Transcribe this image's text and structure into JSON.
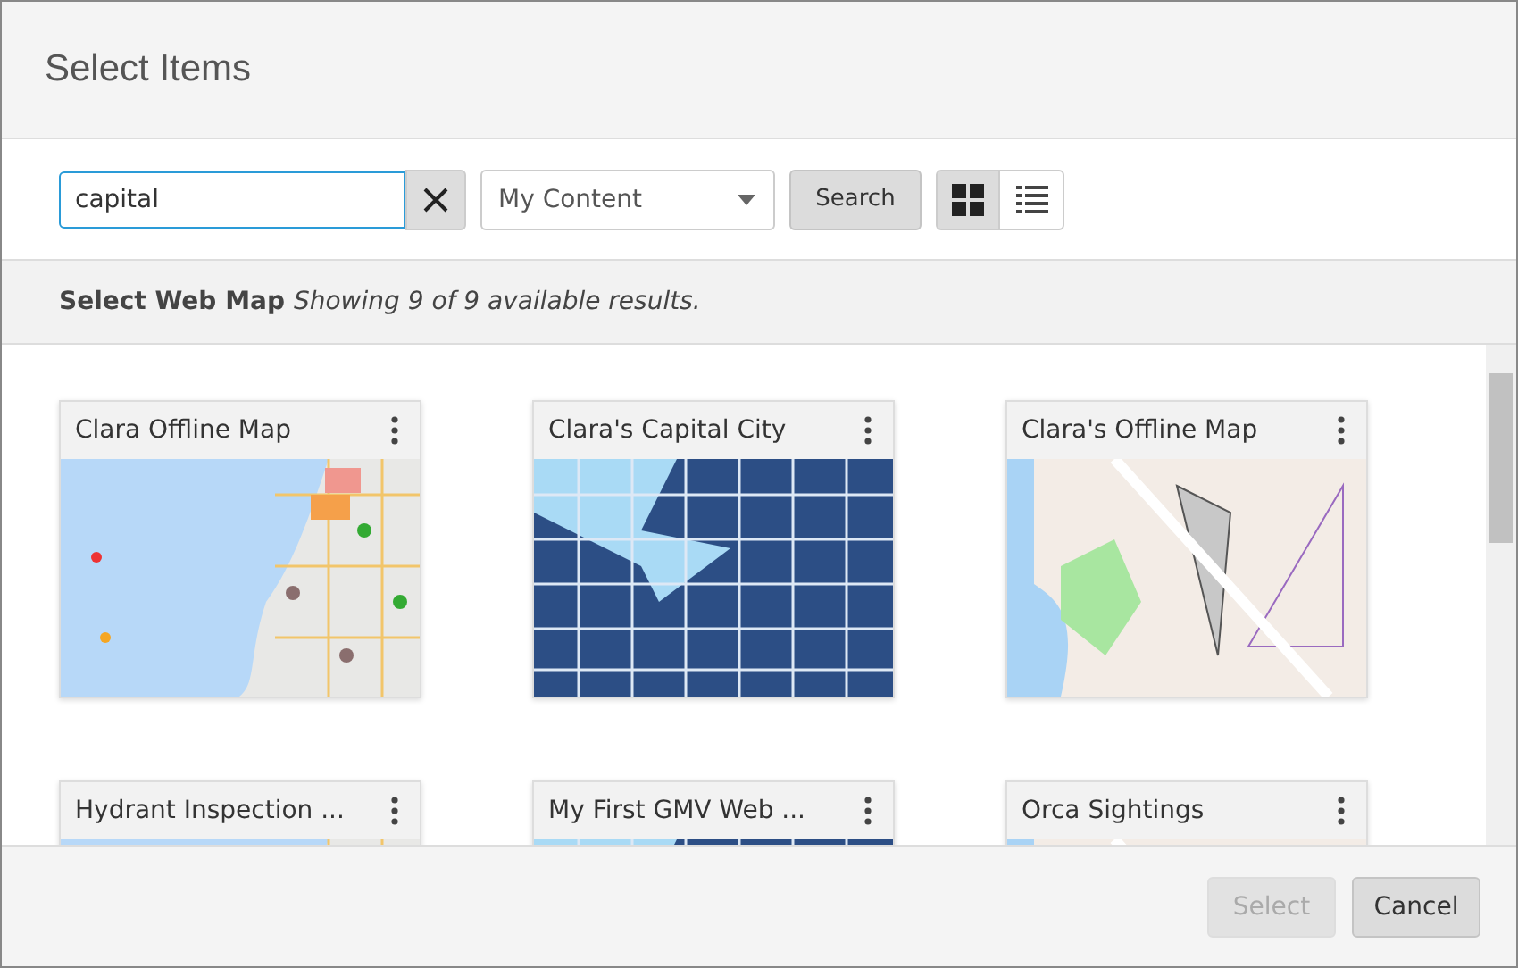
{
  "dialog": {
    "title": "Select Items"
  },
  "toolbar": {
    "search": {
      "value": "capital"
    },
    "scope": {
      "value": "My Content"
    },
    "search_button": "Search",
    "views": [
      {
        "kind": "grid",
        "selected": true
      },
      {
        "kind": "list",
        "selected": false
      }
    ]
  },
  "info": {
    "heading": "Select Web Map",
    "status": "Showing 9 of 9 available results."
  },
  "items": [
    {
      "title": "Clara Offline Map",
      "kind": "streets"
    },
    {
      "title": "Clara's Capital City",
      "kind": "parcels"
    },
    {
      "title": "Clara's Offline Map",
      "kind": "light"
    },
    {
      "title": "Hydrant Inspection ...",
      "kind": "streets"
    },
    {
      "title": "My First GMV Web ...",
      "kind": "parcels"
    },
    {
      "title": "Orca Sightings",
      "kind": "light"
    }
  ],
  "footer": {
    "buttons": [
      {
        "label": "Select",
        "disabled": true
      },
      {
        "label": "Cancel",
        "disabled": false
      }
    ]
  }
}
